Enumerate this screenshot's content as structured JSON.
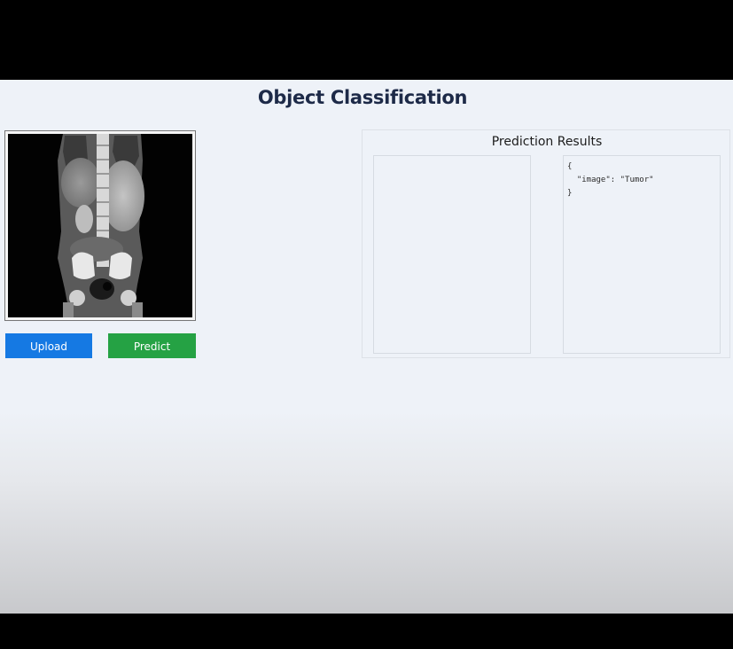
{
  "page": {
    "title": "Object Classification"
  },
  "upload_panel": {
    "image_alt": "coronal CT scan",
    "upload_label": "Upload",
    "predict_label": "Predict"
  },
  "results": {
    "title": "Prediction Results",
    "json_open": "{",
    "json_entry": "  \"image\": \"Tumor\"",
    "json_close": "}"
  },
  "colors": {
    "title_text": "#1d2a48",
    "upload_button": "#1579e3",
    "predict_button": "#25a244",
    "page_background": "#eef2f8"
  }
}
